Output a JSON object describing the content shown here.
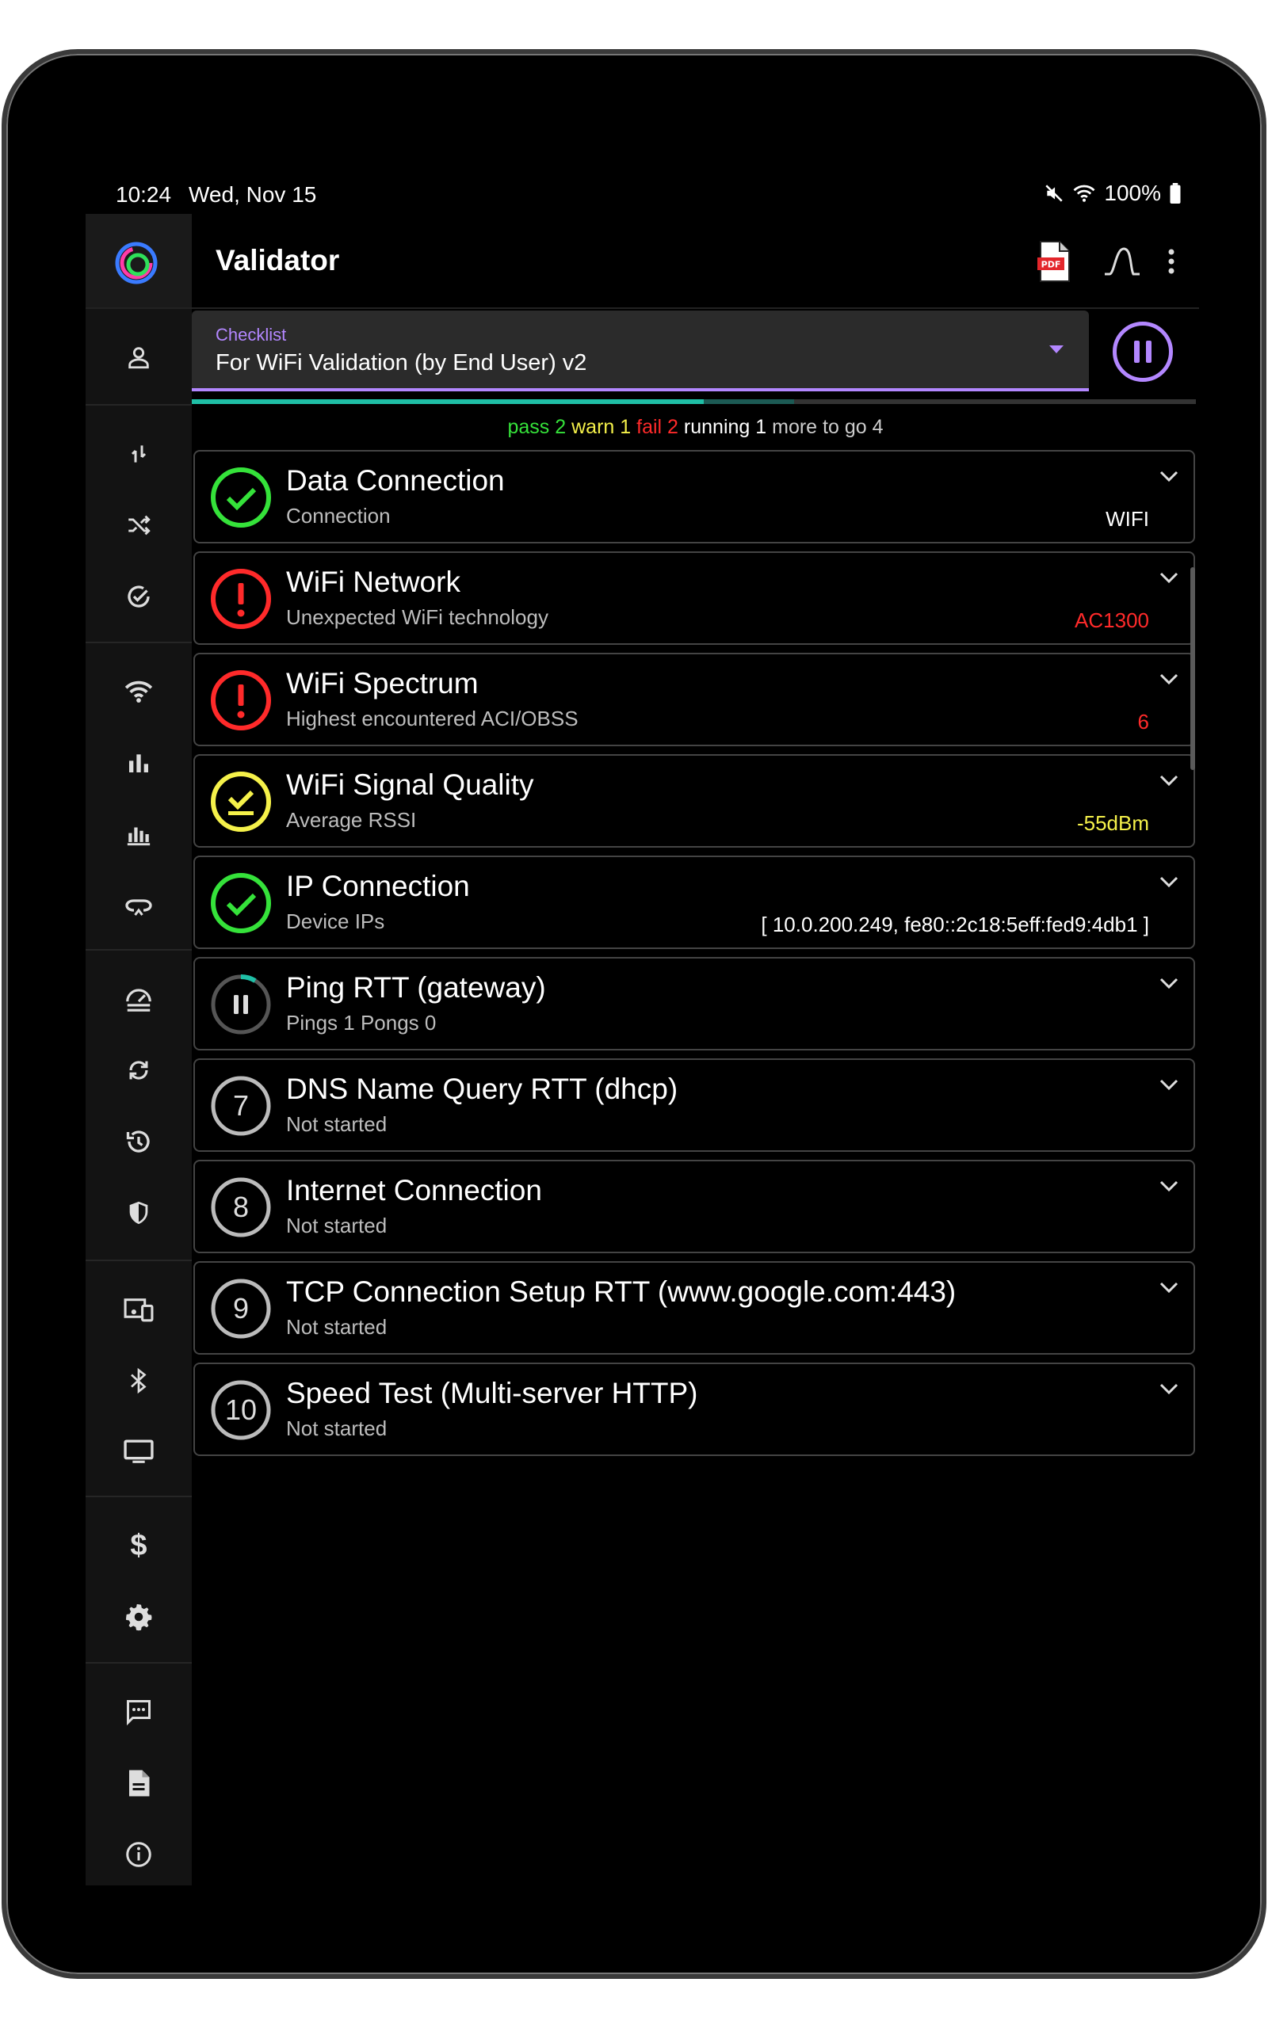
{
  "status": {
    "time": "10:24",
    "date": "Wed, Nov 15",
    "battery": "100%"
  },
  "app": {
    "title": "Validator"
  },
  "checklist": {
    "label": "Checklist",
    "value": "For WiFi Validation (by End User) v2"
  },
  "progress": {
    "done_fraction": 0.51,
    "buffer_fraction": 0.6
  },
  "summary": {
    "pass_label": "pass",
    "pass_count": "2",
    "warn_label": "warn",
    "warn_count": "1",
    "fail_label": "fail",
    "fail_count": "2",
    "running_label": "running",
    "running_count": "1",
    "togo_label": "more to go",
    "togo_count": "4"
  },
  "colors": {
    "accent": "#b387ff",
    "pass": "#35e23a",
    "warn": "#f5f14a",
    "fail": "#ff2a2a",
    "progress": "#1fbfa6"
  },
  "rail_icons": [
    "person-icon",
    "swap-vertical-icon",
    "shuffle-icon",
    "check-circle-icon",
    "wifi-icon",
    "bar-chart-icon",
    "stacked-chart-icon",
    "link-icon",
    "speed-icon",
    "sync-icon",
    "history-icon",
    "shield-icon",
    "devices-icon",
    "bluetooth-icon",
    "monitor-icon",
    "dollar-icon",
    "settings-icon",
    "chat-icon",
    "document-icon",
    "info-icon"
  ],
  "tests": [
    {
      "status": "pass",
      "title": "Data Connection",
      "subtitle": "Connection",
      "value": "WIFI",
      "value_color": "#ffffff"
    },
    {
      "status": "fail",
      "title": "WiFi Network",
      "subtitle": "Unexpected WiFi technology",
      "value": "AC1300",
      "value_color": "#ff2a2a"
    },
    {
      "status": "fail",
      "title": "WiFi Spectrum",
      "subtitle": "Highest encountered ACI/OBSS",
      "value": "6",
      "value_color": "#ff2a2a"
    },
    {
      "status": "warn",
      "title": "WiFi Signal Quality",
      "subtitle": "Average RSSI",
      "value": "-55dBm",
      "value_color": "#f5f14a"
    },
    {
      "status": "pass",
      "title": "IP Connection",
      "subtitle": "Device IPs",
      "value": "[ 10.0.200.249, fe80::2c18:5eff:fed9:4db1 ]",
      "value_color": "#ffffff"
    },
    {
      "status": "running",
      "title": "Ping RTT (gateway)",
      "subtitle": "Pings 1 Pongs 0",
      "value": "",
      "value_color": "#ffffff"
    },
    {
      "status": "pending",
      "number": "7",
      "title": "DNS Name Query RTT (dhcp)",
      "subtitle": "Not started",
      "value": "",
      "value_color": "#ffffff"
    },
    {
      "status": "pending",
      "number": "8",
      "title": "Internet Connection",
      "subtitle": "Not started",
      "value": "",
      "value_color": "#ffffff"
    },
    {
      "status": "pending",
      "number": "9",
      "title": "TCP Connection Setup RTT (www.google.com:443)",
      "subtitle": "Not started",
      "value": "",
      "value_color": "#ffffff"
    },
    {
      "status": "pending",
      "number": "10",
      "title": "Speed Test (Multi-server HTTP)",
      "subtitle": "Not started",
      "value": "",
      "value_color": "#ffffff"
    }
  ]
}
